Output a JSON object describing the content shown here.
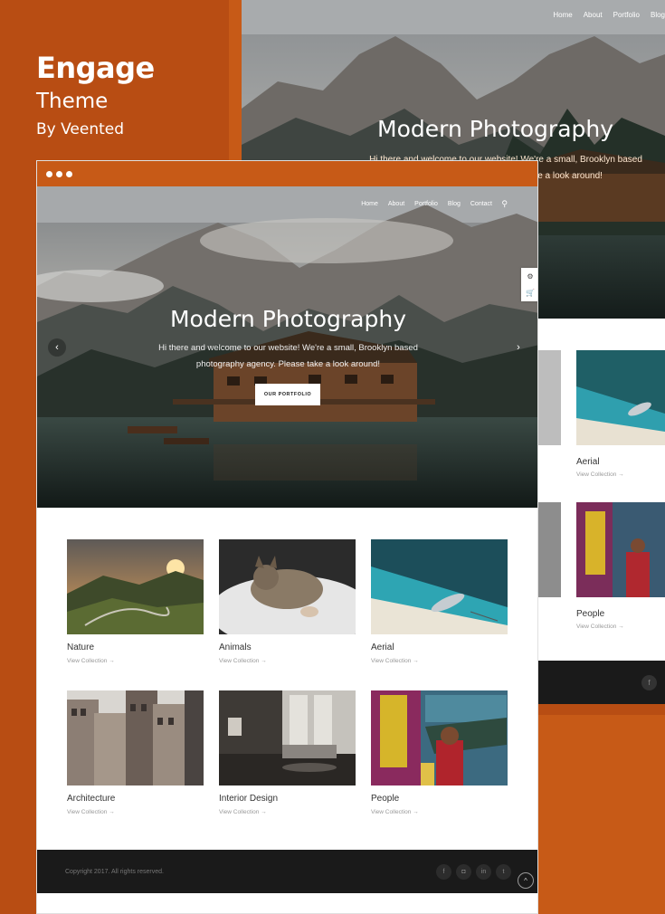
{
  "brand": {
    "title": "Engage",
    "subtitle": "Theme",
    "author": "By Veented"
  },
  "back": {
    "nav": [
      "Home",
      "About",
      "Portfolio",
      "Blog"
    ],
    "hero_title": "Modern Photography",
    "hero_sub": "Hi there and welcome to our website! We're a small, Brooklyn based photography agency. Please take a look around!",
    "items": [
      {
        "caption": "Aerial",
        "link": "View Collection →"
      },
      {
        "caption": "People",
        "link": "View Collection →"
      }
    ],
    "social": "f"
  },
  "front": {
    "nav": [
      "Home",
      "About",
      "Portfolio",
      "Blog",
      "Contact"
    ],
    "search_icon": "⚲",
    "hero_title": "Modern Photography",
    "hero_sub": "Hi there and welcome to our website! We're a small, Brooklyn based photography agency. Please take a look around!",
    "cta": "OUR PORTFOLIO",
    "prev": "‹",
    "next": "›",
    "tools": [
      "⚙",
      "🛒"
    ],
    "collections": [
      {
        "caption": "Nature",
        "link": "View Collection →"
      },
      {
        "caption": "Animals",
        "link": "View Collection →"
      },
      {
        "caption": "Aerial",
        "link": "View Collection →"
      },
      {
        "caption": "Architecture",
        "link": "View Collection →"
      },
      {
        "caption": "Interior Design",
        "link": "View Collection →"
      },
      {
        "caption": "People",
        "link": "View Collection →"
      }
    ],
    "footer": {
      "copyright": "Copyright 2017. All rights reserved.",
      "socials": [
        "f",
        "◘",
        "in",
        "t"
      ],
      "to_top": "^"
    }
  }
}
